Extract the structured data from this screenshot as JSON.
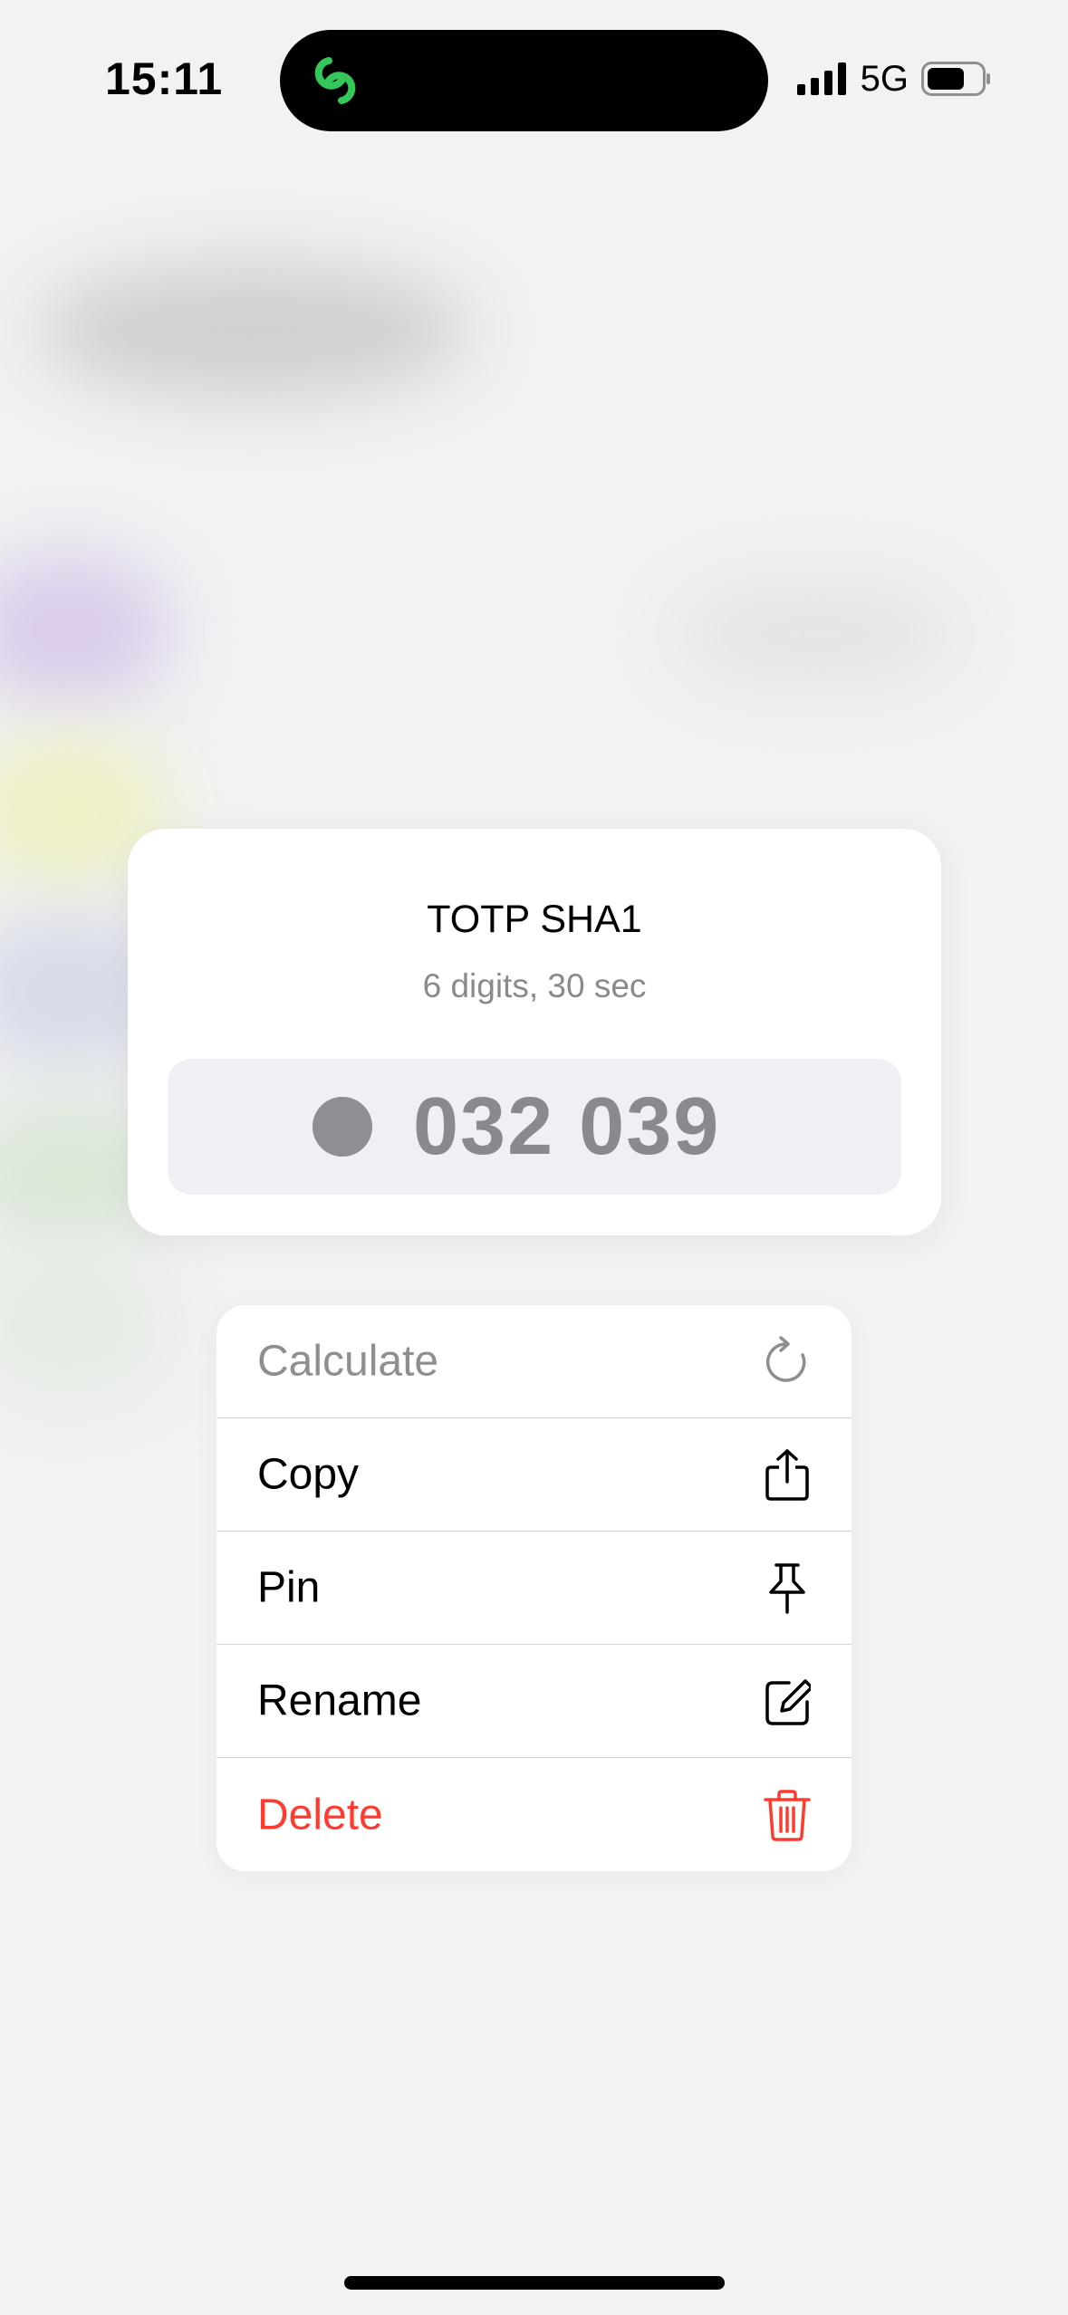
{
  "status_bar": {
    "time": "15:11",
    "network": "5G",
    "island_icon": "link-chain-icon"
  },
  "preview_card": {
    "title": "TOTP SHA1",
    "subtitle": "6 digits, 30 sec",
    "code": "032 039"
  },
  "menu": {
    "items": [
      {
        "label": "Calculate",
        "icon": "refresh-icon",
        "state": "disabled"
      },
      {
        "label": "Copy",
        "icon": "share-icon",
        "state": "normal"
      },
      {
        "label": "Pin",
        "icon": "pin-icon",
        "state": "normal"
      },
      {
        "label": "Rename",
        "icon": "edit-icon",
        "state": "normal"
      },
      {
        "label": "Delete",
        "icon": "trash-icon",
        "state": "destructive"
      }
    ]
  },
  "colors": {
    "destructive": "#ff3b30",
    "disabled": "#8e8e93",
    "island_accent": "#34c759"
  }
}
